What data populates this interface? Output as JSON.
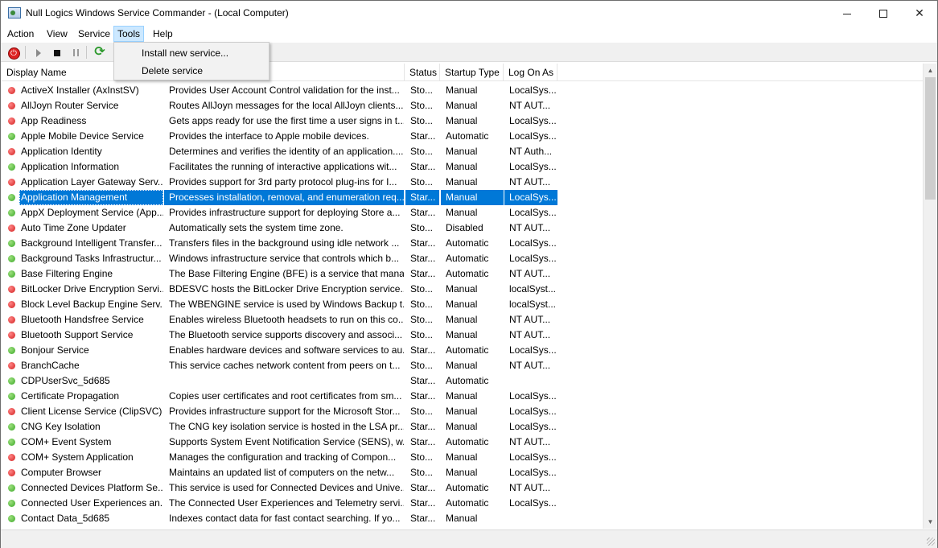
{
  "window": {
    "title": "Null Logics Windows Service Commander - (Local Computer)"
  },
  "menu": {
    "items": [
      "Action",
      "View",
      "Service",
      "Tools",
      "Help"
    ],
    "active": "Tools"
  },
  "tools_dropdown": {
    "items": [
      "Install new service...",
      "Delete service"
    ]
  },
  "toolbar": {
    "icons": [
      "power-icon",
      "start-icon",
      "stop-icon",
      "pause-icon",
      "refresh-icon"
    ]
  },
  "columns": [
    "Display Name",
    "Description",
    "Status",
    "Startup Type",
    "Log On As"
  ],
  "status_colors": {
    "running": "#3aa827",
    "stopped": "#d21f1f",
    "selected": "#0078d7"
  },
  "services": [
    {
      "name": "ActiveX Installer (AxInstSV)",
      "desc": "Provides User Account Control validation for the inst...",
      "status": "Sto...",
      "startup": "Manual",
      "logon": "LocalSys...",
      "state": "stopped"
    },
    {
      "name": "AllJoyn Router Service",
      "desc": "Routes AllJoyn messages for the local AllJoyn clients....",
      "status": "Sto...",
      "startup": "Manual",
      "logon": "NT AUT...",
      "state": "stopped"
    },
    {
      "name": "App Readiness",
      "desc": "Gets apps ready for use the first time a user signs in t...",
      "status": "Sto...",
      "startup": "Manual",
      "logon": "LocalSys...",
      "state": "stopped"
    },
    {
      "name": "Apple Mobile Device Service",
      "desc": "Provides the interface to Apple mobile devices.",
      "status": "Star...",
      "startup": "Automatic",
      "logon": "LocalSys...",
      "state": "running"
    },
    {
      "name": "Application Identity",
      "desc": "Determines and verifies the identity of an application....",
      "status": "Sto...",
      "startup": "Manual",
      "logon": "NT Auth...",
      "state": "stopped"
    },
    {
      "name": "Application Information",
      "desc": "Facilitates the running of interactive applications wit...",
      "status": "Star...",
      "startup": "Manual",
      "logon": "LocalSys...",
      "state": "running"
    },
    {
      "name": "Application Layer Gateway Serv...",
      "desc": "Provides support for 3rd party protocol plug-ins for I...",
      "status": "Sto...",
      "startup": "Manual",
      "logon": "NT AUT...",
      "state": "stopped"
    },
    {
      "name": "Application Management",
      "desc": "Processes installation, removal, and enumeration req...",
      "status": "Star...",
      "startup": "Manual",
      "logon": "LocalSys...",
      "state": "running",
      "selected": true
    },
    {
      "name": "AppX Deployment Service (App...",
      "desc": "Provides infrastructure support for deploying Store a...",
      "status": "Star...",
      "startup": "Manual",
      "logon": "LocalSys...",
      "state": "running"
    },
    {
      "name": "Auto Time Zone Updater",
      "desc": "Automatically sets the system time zone.",
      "status": "Sto...",
      "startup": "Disabled",
      "logon": "NT AUT...",
      "state": "stopped"
    },
    {
      "name": "Background Intelligent Transfer...",
      "desc": "Transfers files in the background using idle network ...",
      "status": "Star...",
      "startup": "Automatic",
      "logon": "LocalSys...",
      "state": "running"
    },
    {
      "name": "Background Tasks Infrastructur...",
      "desc": "Windows infrastructure service that controls which b...",
      "status": "Star...",
      "startup": "Automatic",
      "logon": "LocalSys...",
      "state": "running"
    },
    {
      "name": "Base Filtering Engine",
      "desc": "The Base Filtering Engine (BFE) is a service that mana...",
      "status": "Star...",
      "startup": "Automatic",
      "logon": "NT AUT...",
      "state": "running"
    },
    {
      "name": "BitLocker Drive Encryption Servi...",
      "desc": "BDESVC hosts the BitLocker Drive Encryption service....",
      "status": "Sto...",
      "startup": "Manual",
      "logon": "localSyst...",
      "state": "stopped"
    },
    {
      "name": "Block Level Backup Engine Serv...",
      "desc": "The WBENGINE service is used by Windows Backup t...",
      "status": "Sto...",
      "startup": "Manual",
      "logon": "localSyst...",
      "state": "stopped"
    },
    {
      "name": "Bluetooth Handsfree Service",
      "desc": "Enables wireless Bluetooth headsets to run on this co...",
      "status": "Sto...",
      "startup": "Manual",
      "logon": "NT AUT...",
      "state": "stopped"
    },
    {
      "name": "Bluetooth Support Service",
      "desc": "The Bluetooth service supports discovery and associ...",
      "status": "Sto...",
      "startup": "Manual",
      "logon": "NT AUT...",
      "state": "stopped"
    },
    {
      "name": "Bonjour Service",
      "desc": "Enables hardware devices and software services to au...",
      "status": "Star...",
      "startup": "Automatic",
      "logon": "LocalSys...",
      "state": "running"
    },
    {
      "name": "BranchCache",
      "desc": "This service caches network content from peers on t...",
      "status": "Sto...",
      "startup": "Manual",
      "logon": "NT AUT...",
      "state": "stopped"
    },
    {
      "name": "CDPUserSvc_5d685",
      "desc": "",
      "status": "Star...",
      "startup": "Automatic",
      "logon": "",
      "state": "running"
    },
    {
      "name": "Certificate Propagation",
      "desc": "Copies user certificates and root certificates from sm...",
      "status": "Star...",
      "startup": "Manual",
      "logon": "LocalSys...",
      "state": "running"
    },
    {
      "name": "Client License Service (ClipSVC)",
      "desc": "Provides infrastructure support for the Microsoft Stor...",
      "status": "Sto...",
      "startup": "Manual",
      "logon": "LocalSys...",
      "state": "stopped"
    },
    {
      "name": "CNG Key Isolation",
      "desc": "The CNG key isolation service is hosted in the LSA pr...",
      "status": "Star...",
      "startup": "Manual",
      "logon": "LocalSys...",
      "state": "running"
    },
    {
      "name": "COM+ Event System",
      "desc": "Supports System Event Notification Service (SENS), w...",
      "status": "Star...",
      "startup": "Automatic",
      "logon": "NT AUT...",
      "state": "running"
    },
    {
      "name": "COM+ System Application",
      "desc": "Manages the configuration and tracking of Compon...",
      "status": "Sto...",
      "startup": "Manual",
      "logon": "LocalSys...",
      "state": "stopped"
    },
    {
      "name": "Computer Browser",
      "desc": "Maintains an updated list of computers on the netw...",
      "status": "Sto...",
      "startup": "Manual",
      "logon": "LocalSys...",
      "state": "stopped"
    },
    {
      "name": "Connected Devices Platform Se...",
      "desc": "This service is used for Connected Devices and Unive...",
      "status": "Star...",
      "startup": "Automatic",
      "logon": "NT AUT...",
      "state": "running"
    },
    {
      "name": "Connected User Experiences an...",
      "desc": "The Connected User Experiences and Telemetry servi...",
      "status": "Star...",
      "startup": "Automatic",
      "logon": "LocalSys...",
      "state": "running"
    },
    {
      "name": "Contact Data_5d685",
      "desc": "Indexes contact data for fast contact searching. If yo...",
      "status": "Star...",
      "startup": "Manual",
      "logon": "",
      "state": "running"
    }
  ]
}
